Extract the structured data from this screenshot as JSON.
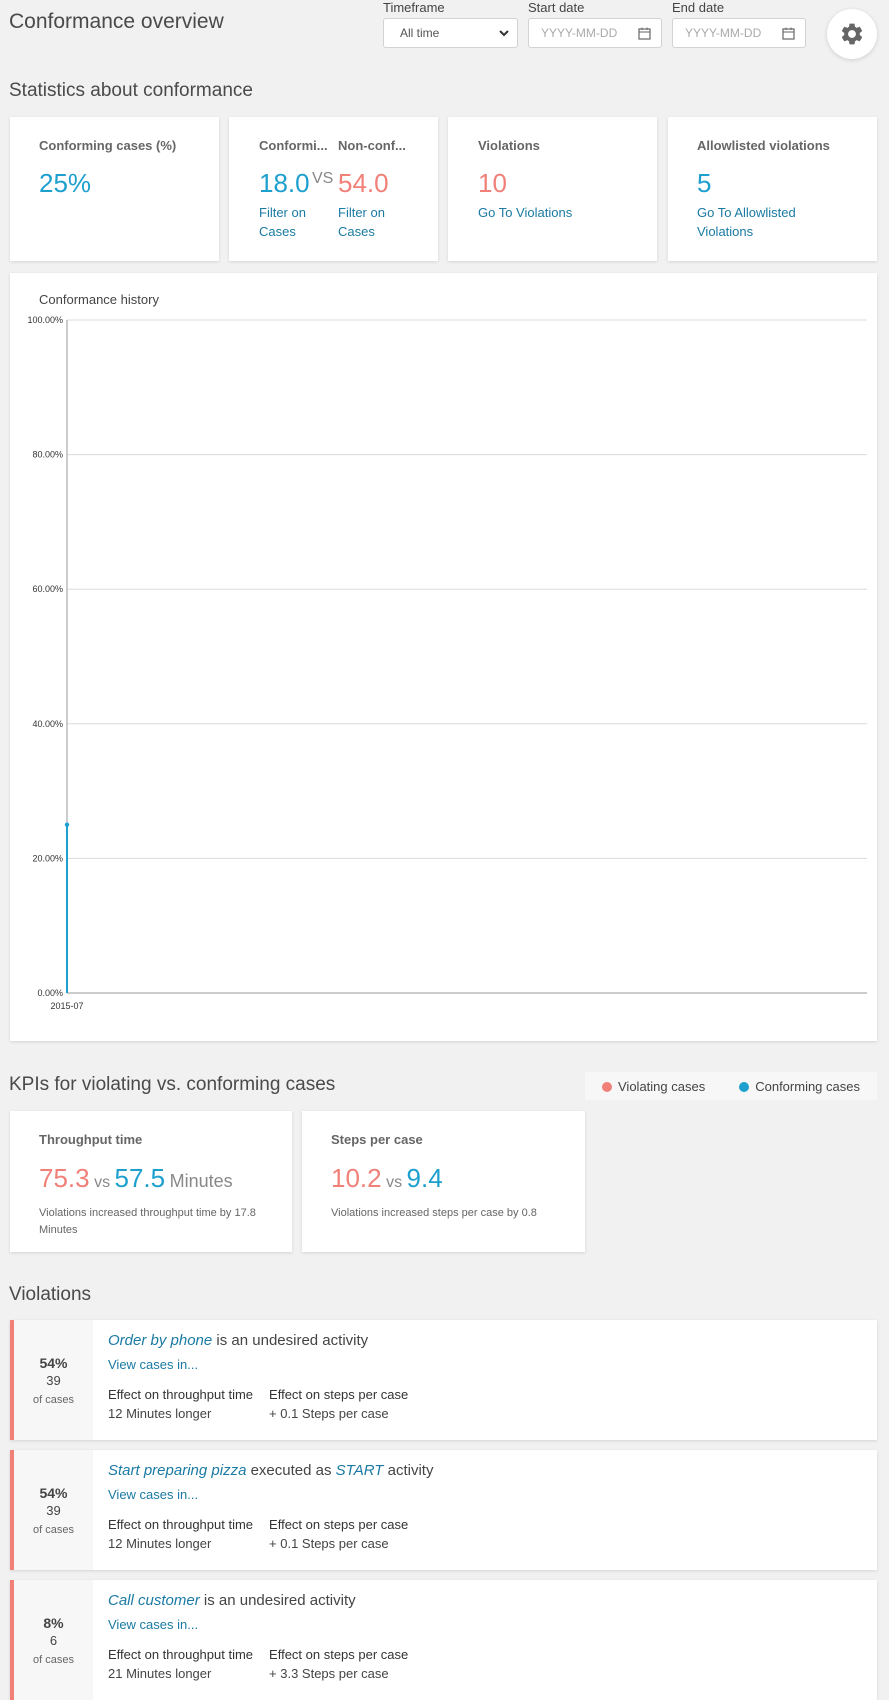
{
  "header": {
    "title": "Conformance overview",
    "timeframe_label": "Timeframe",
    "timeframe_value": "All time",
    "start_label": "Start date",
    "start_placeholder": "YYYY-MM-DD",
    "end_label": "End date",
    "end_placeholder": "YYYY-MM-DD"
  },
  "stats": {
    "title": "Statistics about conformance",
    "conforming_pct_label": "Conforming cases (%)",
    "conforming_pct_value": "25%",
    "conforming_label": "Conformi...",
    "nonconforming_label": "Non-conf...",
    "conforming_value": "18.0",
    "vs": "VS",
    "nonconforming_value": "54.0",
    "filter_link_1": "Filter on Cases",
    "filter_link_2": "Filter on Cases",
    "violations_label": "Violations",
    "violations_value": "10",
    "violations_link": "Go To Violations",
    "allowlisted_label": "Allowlisted violations",
    "allowlisted_value": "5",
    "allowlisted_link": "Go To Allowlisted Violations"
  },
  "chart_data": {
    "type": "line",
    "title": "Conformance history",
    "x": [
      "2015-07"
    ],
    "series": [
      {
        "values": [
          25.0
        ]
      }
    ],
    "ylim": [
      0,
      100
    ],
    "yticks": [
      "0.00%",
      "20.00%",
      "40.00%",
      "60.00%",
      "80.00%",
      "100.00%"
    ],
    "xticks": [
      "2015-07"
    ],
    "grid": true,
    "color": "#1ea0cf"
  },
  "kpis": {
    "title": "KPIs for violating vs. conforming cases",
    "legend": {
      "violating": "Violating cases",
      "conforming": "Conforming cases",
      "violating_color": "#f08078",
      "conforming_color": "#1ea0cf"
    },
    "throughput": {
      "label": "Throughput time",
      "violating": "75.3",
      "vs": "vs",
      "conforming": "57.5",
      "unit": "Minutes",
      "note": "Violations increased throughput time by 17.8 Minutes"
    },
    "steps": {
      "label": "Steps per case",
      "violating": "10.2",
      "vs": "vs",
      "conforming": "9.4",
      "note": "Violations increased steps per case by 0.8"
    }
  },
  "violations": {
    "title": "Violations",
    "items": [
      {
        "pct": "54%",
        "count": "39",
        "of_cases": "of cases",
        "activity": "Order by phone",
        "text": "is an undesired activity",
        "activity2": "",
        "text2": "",
        "link": "View cases in...",
        "throughput_label": "Effect on throughput time",
        "throughput_value": "12 Minutes longer",
        "steps_label": "Effect on steps per case",
        "steps_value": "+ 0.1 Steps per case"
      },
      {
        "pct": "54%",
        "count": "39",
        "of_cases": "of cases",
        "activity": "Start preparing pizza",
        "text": "executed as",
        "activity2": "START",
        "text2": "activity",
        "link": "View cases in...",
        "throughput_label": "Effect on throughput time",
        "throughput_value": "12 Minutes longer",
        "steps_label": "Effect on steps per case",
        "steps_value": "+ 0.1 Steps per case"
      },
      {
        "pct": "8%",
        "count": "6",
        "of_cases": "of cases",
        "activity": "Call customer",
        "text": "is an undesired activity",
        "activity2": "",
        "text2": "",
        "link": "View cases in...",
        "throughput_label": "Effect on throughput time",
        "throughput_value": "21 Minutes longer",
        "steps_label": "Effect on steps per case",
        "steps_value": "+ 3.3 Steps per case"
      }
    ]
  }
}
